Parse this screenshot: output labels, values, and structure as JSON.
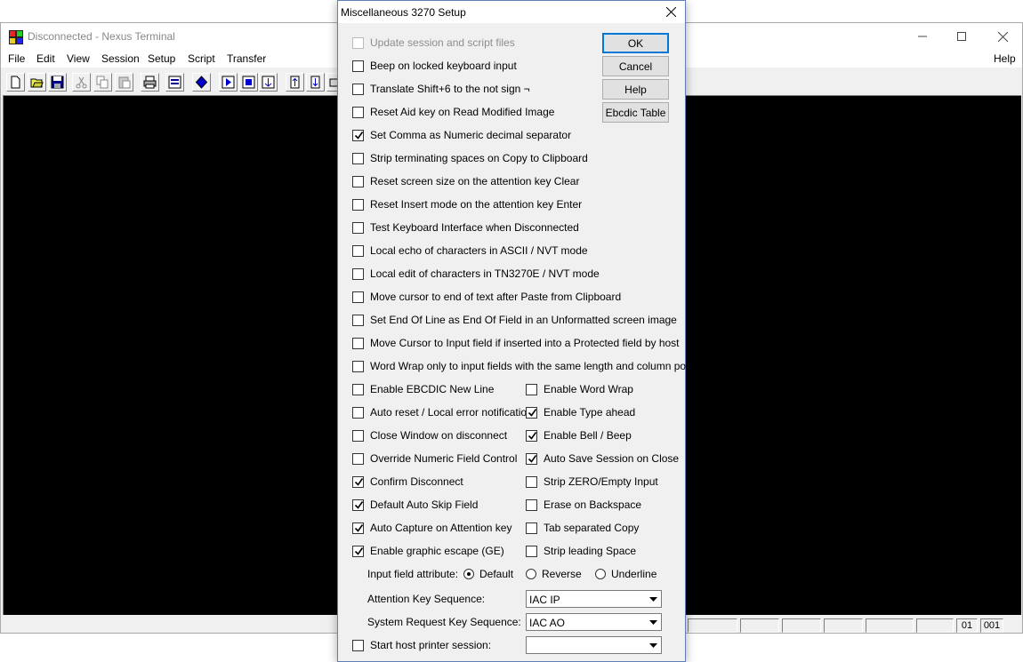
{
  "main_window": {
    "title": "Disconnected - Nexus Terminal",
    "menu": [
      "File",
      "Edit",
      "View",
      "Session",
      "Setup",
      "Script",
      "Transfer"
    ],
    "help_menu": "Help",
    "toolbar_icons": [
      "new-icon",
      "open-icon",
      "save-icon",
      "cut-icon",
      "copy-icon",
      "paste-icon",
      "print-icon",
      "print-screen-icon",
      "record-icon",
      "play-script-icon",
      "stop-script-icon",
      "transfer-icon",
      "upload-icon",
      "download-icon",
      "keyboard-icon"
    ],
    "status": {
      "row": "01",
      "col": "001"
    }
  },
  "dialog": {
    "title": "Miscellaneous 3270 Setup",
    "buttons": {
      "ok": "OK",
      "cancel": "Cancel",
      "help": "Help",
      "ebcdic": "Ebcdic Table"
    },
    "full_options": [
      {
        "label": "Update session and script files",
        "checked": false,
        "disabled": true
      },
      {
        "label": "Beep on locked keyboard input",
        "checked": false
      },
      {
        "label": "Translate Shift+6 to the not sign ¬",
        "checked": false
      },
      {
        "label": "Reset Aid key on Read Modified Image",
        "checked": false
      },
      {
        "label": "Set Comma as Numeric decimal separator",
        "checked": true
      },
      {
        "label": "Strip terminating spaces on Copy to Clipboard",
        "checked": false
      },
      {
        "label": "Reset screen size on the attention key Clear",
        "checked": false
      },
      {
        "label": "Reset Insert mode on the attention key Enter",
        "checked": false
      },
      {
        "label": "Test Keyboard Interface when Disconnected",
        "checked": false
      },
      {
        "label": "Local echo of characters in ASCII / NVT mode",
        "checked": false
      },
      {
        "label": "Local edit of characters in TN3270E / NVT mode",
        "checked": false
      },
      {
        "label": "Move cursor to end of text after Paste from Clipboard",
        "checked": false
      },
      {
        "label": "Set End Of Line as End Of Field in an Unformatted screen image",
        "checked": false
      },
      {
        "label": "Move Cursor to Input field if inserted into a Protected field by host",
        "checked": false
      },
      {
        "label": "Word Wrap only to input fields with the same length and column position",
        "checked": false
      }
    ],
    "left_options": [
      {
        "label": "Enable EBCDIC New Line",
        "checked": false
      },
      {
        "label": "Auto reset / Local error notification",
        "checked": false
      },
      {
        "label": "Close Window on disconnect",
        "checked": false
      },
      {
        "label": "Override Numeric Field Control",
        "checked": false
      },
      {
        "label": "Confirm Disconnect",
        "checked": true
      },
      {
        "label": "Default Auto Skip Field",
        "checked": true
      },
      {
        "label": "Auto Capture on Attention key",
        "checked": true
      },
      {
        "label": "Enable graphic escape (GE)",
        "checked": true
      }
    ],
    "right_options": [
      {
        "label": "Enable Word Wrap",
        "checked": false
      },
      {
        "label": "Enable Type ahead",
        "checked": true
      },
      {
        "label": "Enable Bell / Beep",
        "checked": true
      },
      {
        "label": "Auto Save Session on Close",
        "checked": true
      },
      {
        "label": "Strip ZERO/Empty Input",
        "checked": false
      },
      {
        "label": "Erase on Backspace",
        "checked": false
      },
      {
        "label": "Tab separated Copy",
        "checked": false
      },
      {
        "label": "Strip leading Space",
        "checked": false
      }
    ],
    "input_field_attribute": {
      "label": "Input field attribute:",
      "options": [
        "Default",
        "Reverse",
        "Underline"
      ],
      "selected": "Default"
    },
    "attention_key": {
      "label": "Attention Key Sequence:",
      "value": "IAC IP"
    },
    "sysreq_key": {
      "label": "System Request Key Sequence:",
      "value": "IAC AO"
    },
    "printer": {
      "label": "Start host printer session:",
      "checked": false,
      "value": ""
    }
  }
}
